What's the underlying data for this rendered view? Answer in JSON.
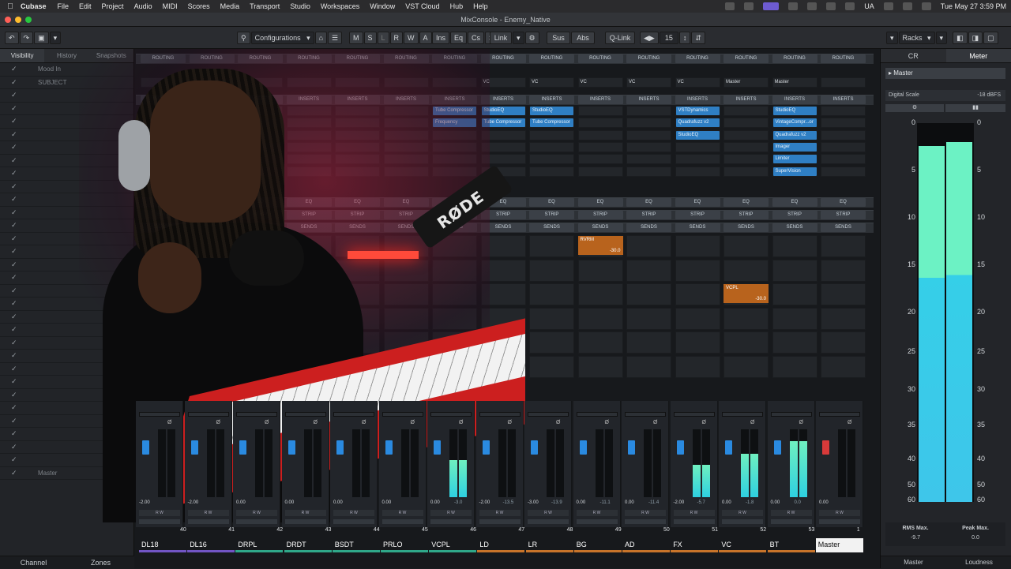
{
  "menubar": {
    "app": "Cubase",
    "items": [
      "File",
      "Edit",
      "Project",
      "Audio",
      "MIDI",
      "Scores",
      "Media",
      "Transport",
      "Studio",
      "Workspaces",
      "Window",
      "VST Cloud",
      "Hub",
      "Help"
    ],
    "lang": "UA",
    "clock": "Tue May 27  3:59 PM"
  },
  "window": {
    "title": "MixConsole - Enemy_Native"
  },
  "toolbar": {
    "configurations": "Configurations",
    "visibility_buttons": [
      "M",
      "S",
      "L",
      "R",
      "W",
      "A"
    ],
    "ins": "Ins",
    "eq": "Eq",
    "cs": "Cs",
    "sd": "Sd",
    "link": "Link",
    "sus": "Sus",
    "abs": "Abs",
    "qlink": "Q-Link",
    "channels": "15",
    "racks": "Racks"
  },
  "left_panel": {
    "tabs": [
      "Visibility",
      "History",
      "Snapshots"
    ],
    "rows": [
      "Mood In",
      "SUBJECT",
      "",
      "",
      "",
      "",
      "",
      "",
      "",
      "",
      "",
      "",
      "",
      "",
      "",
      "",
      "",
      "",
      "",
      "",
      "",
      "",
      "",
      "",
      "",
      "",
      "",
      "",
      "",
      "",
      "",
      "Master"
    ],
    "bottom_tabs": [
      "Channel",
      "Zones"
    ]
  },
  "mixer": {
    "routing_label": "ROUTING",
    "inserts_label": "INSERTS",
    "eq_label": "EQ",
    "strip_label": "STRIP",
    "sends_label": "SENDS",
    "routing_values": [
      "",
      "",
      "",
      "",
      "",
      "",
      "",
      "VC",
      "VC",
      "VC",
      "VC",
      "VC",
      "Master",
      "Master",
      ""
    ],
    "inserts": [
      [],
      [],
      [],
      [],
      [],
      [],
      [
        "Tube Compressor",
        "Frequency"
      ],
      [
        "StudioEQ",
        "Tube Compressor"
      ],
      [
        "StudioEQ",
        "Tube Compressor"
      ],
      [],
      [],
      [
        "VSTDynamics",
        "Quadrafuzz v2",
        "StudioEQ"
      ],
      [],
      [
        "StudioEQ",
        "VintageCompr...or",
        "Quadrafuzz v2",
        "Imager",
        "Limiter",
        "SuperVision"
      ]
    ],
    "sends": [
      {
        "channel": 9,
        "name": "RVRM",
        "level": "-30.0"
      },
      {
        "channel": 12,
        "name": "VCPL",
        "level": "-30.0"
      }
    ]
  },
  "faders": [
    {
      "value": "-2.00",
      "peak": "",
      "level": 0
    },
    {
      "value": "-2.00",
      "peak": "",
      "level": 0
    },
    {
      "value": "0.00",
      "peak": "",
      "level": 0
    },
    {
      "value": "0.00",
      "peak": "",
      "level": 0
    },
    {
      "value": "0.00",
      "peak": "",
      "level": 0
    },
    {
      "value": "0.00",
      "peak": "",
      "level": 0
    },
    {
      "value": "0.00",
      "peak": "-3.0",
      "level": 0.55
    },
    {
      "value": "-2.00",
      "peak": "-13.5",
      "level": 0
    },
    {
      "value": "-3.00",
      "peak": "-13.9",
      "level": 0
    },
    {
      "value": "0.00",
      "peak": "-11.1",
      "level": 0
    },
    {
      "value": "0.00",
      "peak": "-11.4",
      "level": 0
    },
    {
      "value": "-2.00",
      "peak": "-5.7",
      "level": 0.48
    },
    {
      "value": "0.00",
      "peak": "-1.8",
      "level": 0.64
    },
    {
      "value": "0.00",
      "peak": "0.0",
      "level": 0.82
    }
  ],
  "channels": [
    {
      "num": "40",
      "name": "DL18",
      "color": "#7155c4"
    },
    {
      "num": "41",
      "name": "DL16",
      "color": "#7155c4"
    },
    {
      "num": "42",
      "name": "DRPL",
      "color": "#2fa889"
    },
    {
      "num": "43",
      "name": "DRDT",
      "color": "#2fa889"
    },
    {
      "num": "44",
      "name": "BSDT",
      "color": "#2fa889"
    },
    {
      "num": "45",
      "name": "PRLO",
      "color": "#2fa889"
    },
    {
      "num": "46",
      "name": "VCPL",
      "color": "#2fa889"
    },
    {
      "num": "47",
      "name": "LD",
      "color": "#c8742a"
    },
    {
      "num": "48",
      "name": "LR",
      "color": "#c8742a"
    },
    {
      "num": "49",
      "name": "BG",
      "color": "#c8742a"
    },
    {
      "num": "50",
      "name": "AD",
      "color": "#c8742a"
    },
    {
      "num": "51",
      "name": "FX",
      "color": "#c8742a"
    },
    {
      "num": "52",
      "name": "VC",
      "color": "#c8742a"
    },
    {
      "num": "53",
      "name": "BT",
      "color": "#c8742a"
    },
    {
      "num": "1",
      "name": "Master",
      "color": "#f2f2f2"
    }
  ],
  "right_panel": {
    "tabs": [
      "CR",
      "Meter"
    ],
    "master": "Master",
    "digital_scale": "Digital Scale",
    "digital_value": "-18 dBFS",
    "scale": [
      "0",
      "5",
      "10",
      "15",
      "20",
      "25",
      "30",
      "35",
      "40",
      "50",
      "60"
    ],
    "meter_levels": [
      0.94,
      0.95
    ],
    "rms_label": "RMS Max.",
    "rms_value": "-9.7",
    "peak_label": "Peak Max.",
    "peak_value": "0.0",
    "bottom_tabs": [
      "Master",
      "Loudness"
    ]
  }
}
